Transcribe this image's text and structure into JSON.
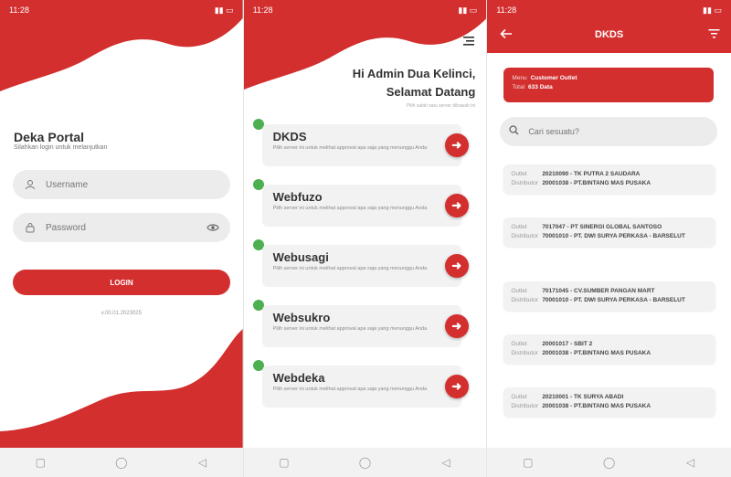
{
  "status": {
    "time": "11:28"
  },
  "login": {
    "title": "Deka Portal",
    "subtitle": "Silahkan login untuk melanjutkan",
    "username_placeholder": "Username",
    "password_placeholder": "Password",
    "login_label": "LOGIN",
    "version": "v.00.01.2023025"
  },
  "home": {
    "greeting_line1": "Hi Admin Dua Kelinci,",
    "greeting_line2": "Selamat Datang",
    "greeting_sub": "Pilih salah satu server dibawah ini",
    "apps": [
      {
        "name": "DKDS",
        "desc": "Pilih server ini untuk melihat approval apa saja yang menunggu Anda"
      },
      {
        "name": "Webfuzo",
        "desc": "Pilih server ini untuk melihat approval apa saja yang menunggu Anda"
      },
      {
        "name": "Webusagi",
        "desc": "Pilih server ini untuk melihat approval apa saja yang menunggu Anda"
      },
      {
        "name": "Websukro",
        "desc": "Pilih server ini untuk melihat approval apa saja yang menunggu Anda"
      },
      {
        "name": "Webdeka",
        "desc": "Pilih server ini untuk melihat approval apa saja yang menunggu Anda"
      }
    ]
  },
  "list": {
    "title": "DKDS",
    "menu_label": "Menu",
    "menu_value": "Customer Outlet",
    "total_label": "Total",
    "total_value": "633 Data",
    "search_placeholder": "Cari sesuatu?",
    "outlet_label": "Outlet",
    "distributor_label": "Distributor",
    "outlets": [
      {
        "outlet": "20210090 - TK PUTRA 2 SAUDARA",
        "distributor": "20001038 - PT.BINTANG MAS PUSAKA"
      },
      {
        "outlet": "7017047 - PT SINERGI GLOBAL SANTOSO",
        "distributor": "70001010 - PT. DWI SURYA PERKASA - BARSELUT"
      },
      {
        "outlet": "70171045 - CV.SUMBER PANGAN MART",
        "distributor": "70001010 - PT. DWI SURYA PERKASA - BARSELUT"
      },
      {
        "outlet": "20001017 - SBIT 2",
        "distributor": "20001038 - PT.BINTANG MAS PUSAKA"
      },
      {
        "outlet": "20210001 - TK SURYA ABADI",
        "distributor": "20001038 - PT.BINTANG MAS PUSAKA"
      }
    ]
  },
  "colors": {
    "accent": "#d32f2f",
    "online": "#4caf50"
  }
}
